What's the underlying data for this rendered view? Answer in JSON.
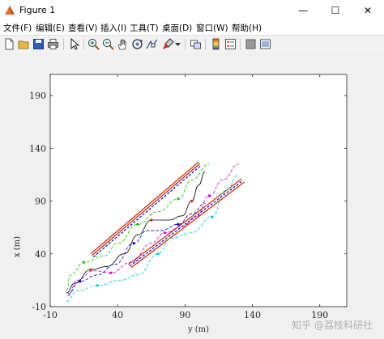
{
  "window": {
    "title": "Figure 1",
    "controls": {
      "minimize": "—",
      "maximize": "☐",
      "close": "✕"
    }
  },
  "menu": [
    "文件(F)",
    "编辑(E)",
    "查看(V)",
    "插入(I)",
    "工具(T)",
    "桌面(D)",
    "窗口(W)",
    "帮助(H)"
  ],
  "toolbar_icons": [
    "new-figure-icon",
    "open-folder-icon",
    "save-icon",
    "print-icon",
    "pointer-icon",
    "zoom-in-icon",
    "zoom-out-icon",
    "pan-hand-icon",
    "rotate-3d-icon",
    "data-cursor-icon",
    "brush-icon",
    "brush-dropdown-icon",
    "link-plot-icon",
    "colorbar-icon",
    "legend-icon",
    "hide-plot-tools-icon",
    "show-plot-tools-icon"
  ],
  "watermark": "知乎 @荔枝科研社",
  "chart_data": {
    "type": "line",
    "xlabel": "y (m)",
    "ylabel": "x (m)",
    "xlim": [
      -10,
      210
    ],
    "ylim": [
      -10,
      210
    ],
    "xticks": [
      "-10",
      "40",
      "90",
      "140",
      "190"
    ],
    "yticks": [
      "-10",
      "40",
      "90",
      "140",
      "190"
    ],
    "grid": false,
    "boundaries": [
      {
        "color": "#cc2200",
        "style": "solid",
        "points": [
          [
            20,
            40
          ],
          [
            100,
            127
          ]
        ]
      },
      {
        "color": "#cc2200",
        "style": "solid",
        "points": [
          [
            21,
            38.5
          ],
          [
            101,
            125.5
          ]
        ]
      },
      {
        "color": "#0000cc",
        "style": "dashed",
        "points": [
          [
            22,
            37
          ],
          [
            102,
            124
          ]
        ]
      },
      {
        "color": "#cc2200",
        "style": "solid",
        "points": [
          [
            48,
            30
          ],
          [
            132,
            111
          ]
        ]
      },
      {
        "color": "#0000cc",
        "style": "dashed",
        "points": [
          [
            49,
            28.5
          ],
          [
            133,
            109.5
          ]
        ]
      },
      {
        "color": "#cc2200",
        "style": "solid",
        "points": [
          [
            50,
            27
          ],
          [
            134,
            108
          ]
        ]
      }
    ],
    "trajectories": [
      {
        "color": "#00cc00",
        "style": "dashed",
        "points": [
          [
            2,
            5
          ],
          [
            5,
            20
          ],
          [
            15,
            32
          ],
          [
            30,
            38
          ],
          [
            40,
            50
          ],
          [
            55,
            68
          ],
          [
            70,
            80
          ],
          [
            85,
            92
          ],
          [
            95,
            110
          ],
          [
            108,
            125
          ]
        ]
      },
      {
        "color": "#000000",
        "style": "solid",
        "points": [
          [
            2,
            3
          ],
          [
            8,
            12
          ],
          [
            20,
            25
          ],
          [
            32,
            28
          ],
          [
            45,
            40
          ],
          [
            55,
            58
          ],
          [
            65,
            72
          ],
          [
            78,
            72
          ],
          [
            88,
            76
          ],
          [
            95,
            90
          ],
          [
            100,
            105
          ],
          [
            105,
            118
          ]
        ]
      },
      {
        "color": "#cc00cc",
        "style": "dashed",
        "points": [
          [
            3,
            0
          ],
          [
            10,
            15
          ],
          [
            22,
            24
          ],
          [
            35,
            22
          ],
          [
            50,
            32
          ],
          [
            65,
            50
          ],
          [
            75,
            60
          ],
          [
            88,
            66
          ],
          [
            98,
            75
          ],
          [
            108,
            95
          ],
          [
            118,
            110
          ],
          [
            130,
            125
          ]
        ]
      },
      {
        "color": "#0000cc",
        "style": "dashed",
        "points": [
          [
            3,
            2
          ],
          [
            12,
            14
          ],
          [
            25,
            20
          ],
          [
            38,
            30
          ],
          [
            52,
            50
          ],
          [
            62,
            62
          ],
          [
            72,
            62
          ],
          [
            85,
            68
          ],
          [
            95,
            78
          ],
          [
            105,
            88
          ]
        ]
      },
      {
        "color": "#00cccc",
        "style": "dashed",
        "points": [
          [
            2,
            -5
          ],
          [
            10,
            5
          ],
          [
            25,
            10
          ],
          [
            42,
            15
          ],
          [
            55,
            20
          ],
          [
            70,
            40
          ],
          [
            80,
            55
          ],
          [
            95,
            60
          ],
          [
            110,
            75
          ],
          [
            120,
            100
          ],
          [
            130,
            115
          ]
        ]
      }
    ],
    "markers": [
      {
        "color": "#00cc00",
        "points": [
          [
            15,
            32
          ],
          [
            55,
            68
          ],
          [
            85,
            92
          ]
        ]
      },
      {
        "color": "#cc00cc",
        "points": [
          [
            35,
            22
          ],
          [
            75,
            60
          ],
          [
            108,
            95
          ]
        ]
      },
      {
        "color": "#0000cc",
        "points": [
          [
            12,
            14
          ],
          [
            52,
            50
          ],
          [
            85,
            68
          ]
        ]
      },
      {
        "color": "#00cccc",
        "points": [
          [
            25,
            10
          ],
          [
            70,
            40
          ],
          [
            110,
            75
          ]
        ]
      },
      {
        "color": "#cc2200",
        "points": [
          [
            20,
            25
          ],
          [
            65,
            72
          ],
          [
            95,
            90
          ]
        ]
      }
    ]
  }
}
